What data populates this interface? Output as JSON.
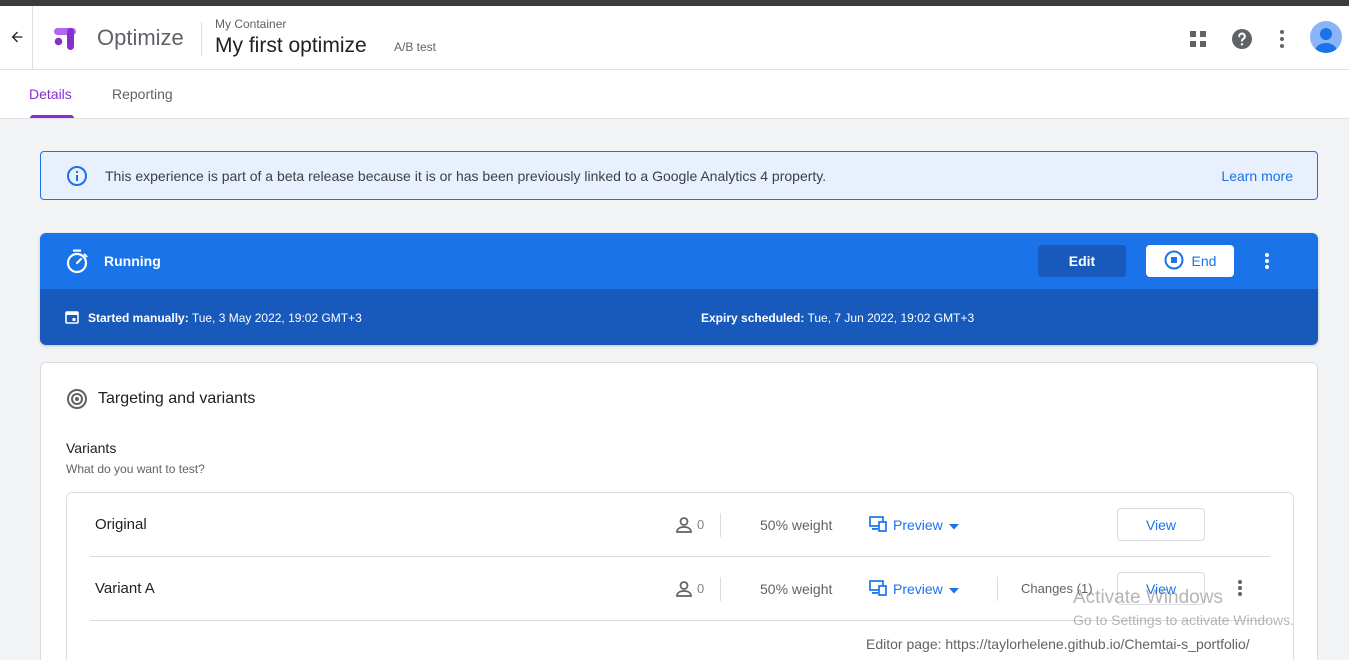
{
  "header": {
    "app_name": "Optimize",
    "container_label": "My Container",
    "experience_title": "My first optimize",
    "experience_type": "A/B test"
  },
  "tabs": [
    {
      "label": "Details",
      "active": true
    },
    {
      "label": "Reporting",
      "active": false
    }
  ],
  "banner": {
    "text": "This experience is part of a beta release because it is or has been previously linked to a Google Analytics 4 property.",
    "link": "Learn more"
  },
  "status": {
    "label": "Running",
    "edit_label": "Edit",
    "end_label": "End",
    "started_key": "Started manually:",
    "started_value": " Tue, 3 May 2022, 19:02 GMT+3",
    "expiry_key": "Expiry scheduled:",
    "expiry_value": " Tue, 7 Jun 2022, 19:02 GMT+3"
  },
  "card": {
    "title": "Targeting and variants",
    "variants_title": "Variants",
    "variants_subtitle": "What do you want to test?",
    "variants": [
      {
        "name": "Original",
        "count": "0",
        "weight": "50% weight",
        "preview": "Preview",
        "view": "View"
      },
      {
        "name": "Variant A",
        "count": "0",
        "weight": "50% weight",
        "preview": "Preview",
        "changes": "Changes (1)",
        "view": "View"
      }
    ],
    "editor_page": "Editor page: https://taylorhelene.github.io/Chemtai-s_portfolio/"
  },
  "watermark": {
    "line1": "Activate Windows",
    "line2": "Go to Settings to activate Windows."
  },
  "colors": {
    "accent_purple": "#8430ce",
    "primary_blue": "#1a73e8",
    "dark_blue": "#185abc",
    "banner_bg": "#e8f0fe"
  },
  "icons": [
    "back-arrow-icon",
    "optimize-logo-icon",
    "apps-grid-icon",
    "help-icon",
    "more-vert-icon",
    "account-avatar-icon",
    "info-icon",
    "timer-icon",
    "stop-circle-icon",
    "calendar-icon",
    "target-icon",
    "person-icon",
    "device-preview-icon",
    "dropdown-arrow-icon"
  ]
}
